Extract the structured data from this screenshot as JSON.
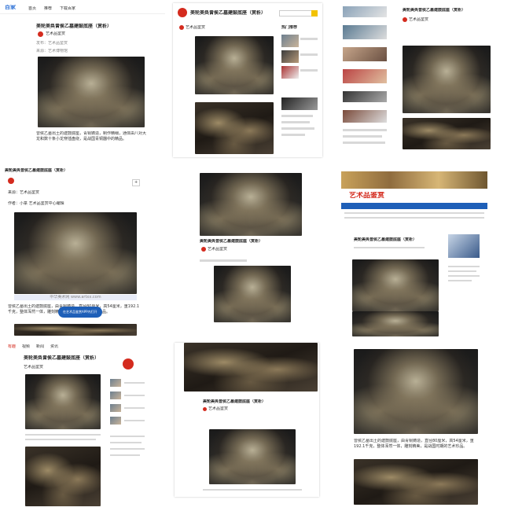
{
  "panels": [
    {
      "nav": [
        "百家",
        "首页",
        "推荐",
        "下载百家"
      ],
      "title": "美轮美奂曾侯乙墓建鼓底座（赏析）",
      "author": "艺术品鉴赏",
      "meta": "发布：艺术品鉴赏",
      "source": "来源：艺术博物馆",
      "caption": "曾侯乙墓出土的建鼓底座，青铜铸造，制作精细，通体由八对大龙和数十条小龙穿插盘绕，是战国青铜器中的精品。"
    },
    {
      "title": "美轮美奂曾侯乙墓建鼓底座（赏析）",
      "author": "艺术品鉴赏",
      "sidebar_heading": "热门推荐",
      "search_placeholder": ""
    },
    {
      "title": "美轮美奂曾侯乙墓建鼓底座（赏析）",
      "author": "艺术品鉴赏"
    },
    {
      "title": "美轮美奂曾侯乙墓建鼓底座（赏析）",
      "source": "来源：艺术品鉴赏",
      "author_line": "作者：小篆 艺术品鉴赏中心编辑",
      "image_caption": "中华美术网 www.artxx.com",
      "caption": "曾侯乙墓出土的建鼓底座，由青铜铸造，直径80厘米，高54厘米，重192.1千克，整体浑然一体，雕刻精美，是战国时期的艺术珍品。",
      "app_button": "在艺术品鉴赏APP内打开"
    },
    {
      "title": "美轮美奂曾侯乙墓建鼓底座（赏析）",
      "author": "艺术品鉴赏"
    },
    {
      "site_name": "艺术品鉴赏",
      "title": "美轮美奂曾侯乙墓建鼓底座（赏析）"
    },
    {
      "nav": [
        "有趣",
        "视频",
        "新闻",
        "资讯"
      ],
      "title": "美轮美奂曾侯乙墓建鼓底座（赏析）",
      "author": "艺术品鉴赏"
    },
    {
      "title": "美轮美奂曾侯乙墓建鼓底座（赏析）",
      "author": "艺术品鉴赏"
    },
    {
      "caption": "曾侯乙墓出土的建鼓底座，由青铜铸造，直径80厘米，高54厘米，重192.1千克，整体浑然一体，雕刻精美，是战国时期的艺术珍品。"
    }
  ],
  "colors": {
    "accent_red": "#d42b1e",
    "site_blue": "#1e5fb8",
    "yellow_btn": "#f2c200"
  }
}
